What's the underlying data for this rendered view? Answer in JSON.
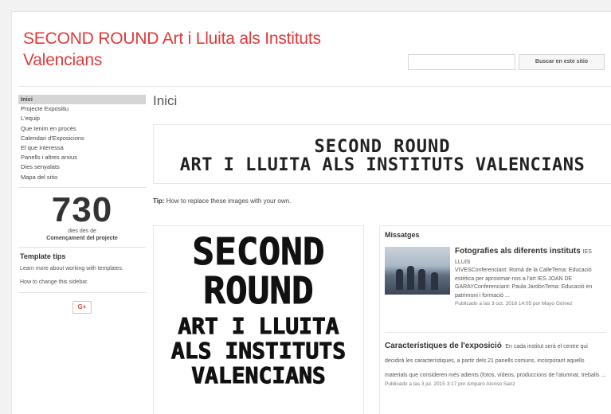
{
  "header": {
    "site_title": "SECOND ROUND Art i Lluita als Instituts Valencians",
    "search_button": "Buscar en este sitio"
  },
  "sidebar": {
    "items": [
      {
        "label": "Inici",
        "active": true
      },
      {
        "label": "Projecte Expositiu"
      },
      {
        "label": "L'equip"
      },
      {
        "label": "Que tenim en procés"
      },
      {
        "label": "Calendari d'Exposicions"
      },
      {
        "label": "El que interessa"
      },
      {
        "label": "Panells i altres arxius"
      },
      {
        "label": "Dies senyalats"
      },
      {
        "label": "Mapa del sitio"
      }
    ],
    "counter": {
      "value": "730",
      "label1": "dies des de",
      "label2": "Començament del projecte"
    },
    "template_tips": {
      "title": "Template tips",
      "text1": "Learn more about working with templates.",
      "text2": "How to change this sidebar."
    },
    "gplus_label": "G+"
  },
  "main": {
    "page_title": "Inici",
    "banner_line1": "SECOND ROUND",
    "banner_line2": "ART I LLUITA ALS INSTITUTS VALENCIANS",
    "tip_label": "Tip:",
    "tip_text": "How to replace these images with your own.",
    "poster_lines": [
      "SECOND",
      "ROUND",
      "ART I LLUITA",
      "ALS INSTITUTS",
      "VALENCIANS"
    ]
  },
  "messages": {
    "title": "Missatges",
    "post1": {
      "title": "Fotografies als diferents instituts",
      "inline": "IES LLUIS",
      "text": "VIVESConferenciant: Romà de la CalleTema: Educació estètica per aproximar-nos a l'art IES JOAN DE GARAYConferenciant: Paula JardónTema: Educació en patrimoni i formació ...",
      "meta": "Publicado a las 3 oct. 2016 14:05 por Mayo Gómez"
    },
    "post2": {
      "title": "Característiques de l'exposició",
      "text": "En cada institut serà el centre qui decidirà les característiques, a partir dels 21 panells comuns, incorporant aquells materials que consideren més adients (fotos, vídeos, produccions de l'alumnat, treballs ...",
      "meta": "Publicado a las 3 jul. 2015 3:17 por Amparo Alonso Sanz"
    }
  }
}
